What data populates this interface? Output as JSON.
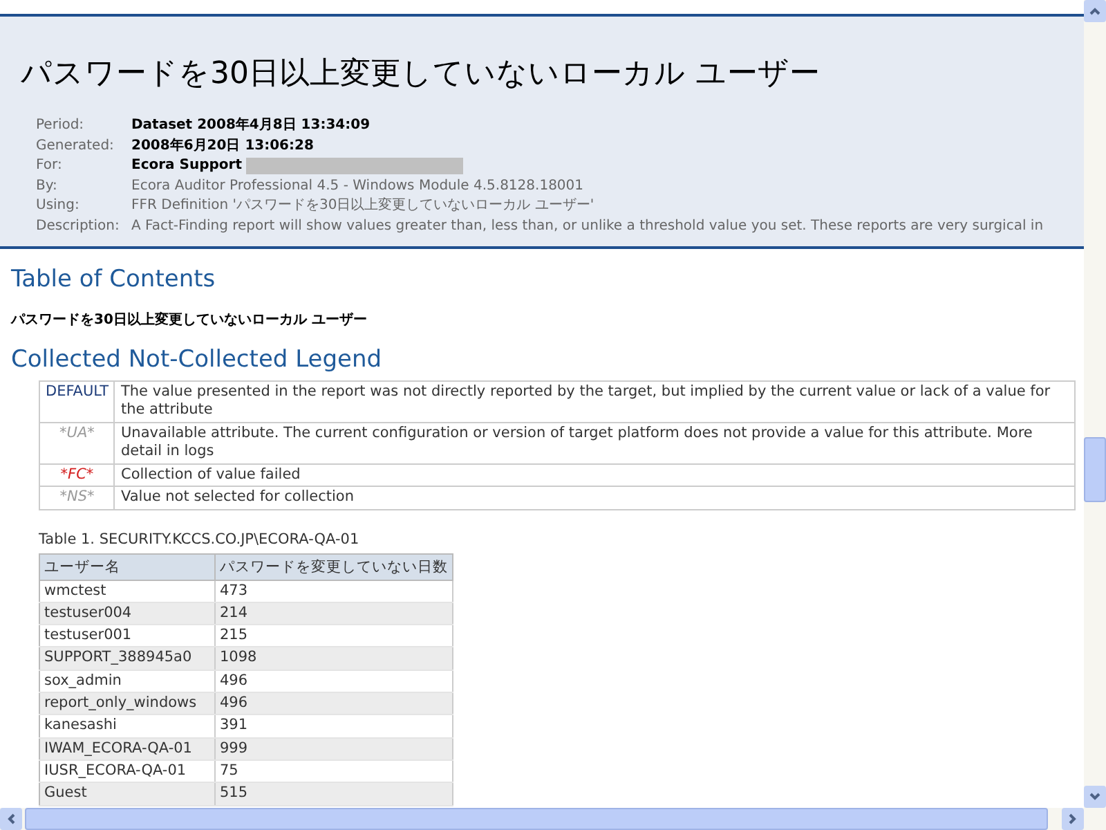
{
  "header": {
    "title": "パスワードを30日以上変更していないローカル ユーザー",
    "meta": [
      {
        "label": "Period:",
        "value": "Dataset 2008年4月8日 13:34:09",
        "bold": true
      },
      {
        "label": "Generated:",
        "value": "2008年6月20日 13:06:28",
        "bold": true
      },
      {
        "label": "For:",
        "value": "Ecora Support",
        "bold": true,
        "redacted": true
      },
      {
        "label": "By:",
        "value": "Ecora Auditor Professional 4.5 - Windows Module 4.5.8128.18001",
        "bold": false
      },
      {
        "label": "Using:",
        "value": "FFR Definition 'パスワードを30日以上変更していないローカル ユーザー'",
        "bold": false
      },
      {
        "label": "Description:",
        "value": "A Fact-Finding report will show values greater than, less than, or unlike a threshold value you set. These reports are very surgical in",
        "bold": false
      }
    ]
  },
  "toc": {
    "heading": "Table of Contents",
    "items": [
      "パスワードを30日以上変更していないローカル ユーザー"
    ]
  },
  "legend": {
    "heading": "Collected Not-Collected Legend",
    "rows": [
      {
        "code": "DEFAULT",
        "color": "#1f3d7a",
        "italic": false,
        "text": "The value presented in the report was not directly reported by the target, but implied by the current value or lack of a value for the attribute"
      },
      {
        "code": "*UA*",
        "color": "#9a9a9a",
        "italic": true,
        "text": "Unavailable attribute. The current configuration or version of target platform does not provide a value for this attribute. More detail in logs"
      },
      {
        "code": "*FC*",
        "color": "#d42020",
        "italic": true,
        "text": "Collection of value failed"
      },
      {
        "code": "*NS*",
        "color": "#9a9a9a",
        "italic": true,
        "text": "Value not selected for collection"
      }
    ]
  },
  "table": {
    "caption": "Table 1. SECURITY.KCCS.CO.JP\\ECORA-QA-01",
    "columns": [
      "ユーザー名",
      "パスワードを変更していない日数"
    ],
    "rows": [
      [
        "wmctest",
        "473"
      ],
      [
        "testuser004",
        "214"
      ],
      [
        "testuser001",
        "215"
      ],
      [
        "SUPPORT_388945a0",
        "1098"
      ],
      [
        "sox_admin",
        "496"
      ],
      [
        "report_only_windows",
        "496"
      ],
      [
        "kanesashi",
        "391"
      ],
      [
        "IWAM_ECORA-QA-01",
        "999"
      ],
      [
        "IUSR_ECORA-QA-01",
        "75"
      ],
      [
        "Guest",
        "515"
      ]
    ]
  }
}
